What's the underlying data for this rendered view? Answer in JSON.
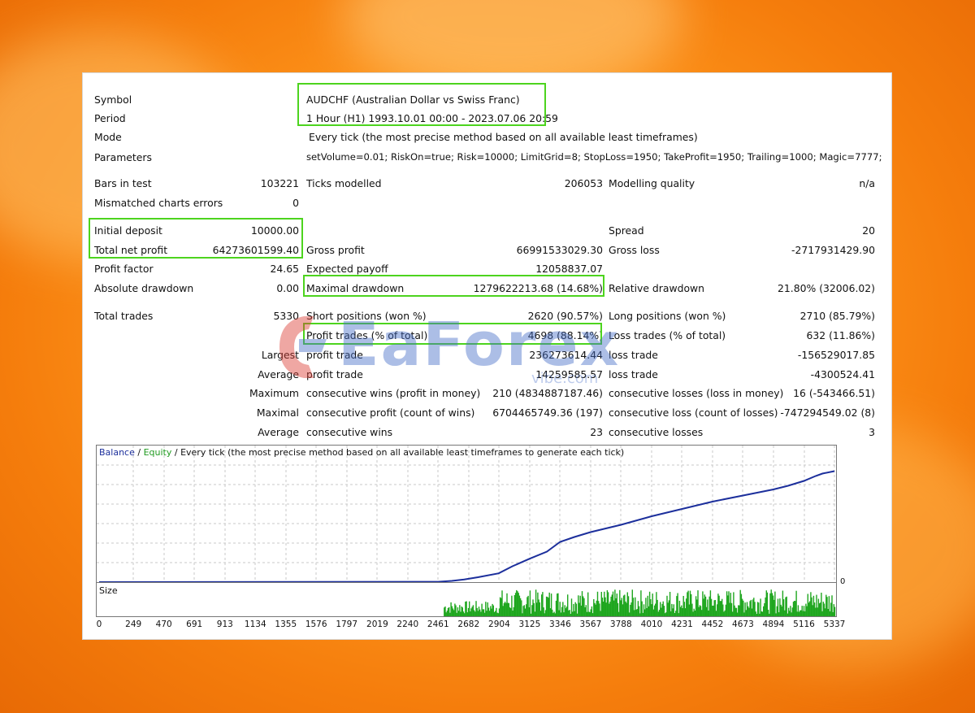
{
  "colors": {
    "balance": "#1c2f9c",
    "equity": "#1f9a1f",
    "volume_bars": "#1fa61f",
    "highlight": "#4dd41e",
    "grid": "#c8c8c8"
  },
  "header": [
    {
      "label": "Symbol",
      "value": "AUDCHF (Australian Dollar vs Swiss Franc)"
    },
    {
      "label": "Period",
      "value": "1 Hour (H1) 1993.10.01 00:00 - 2023.07.06 20:59"
    },
    {
      "label": "Mode",
      "value": "Every tick (the most precise method based on all available least timeframes)"
    },
    {
      "label": "Parameters",
      "value": "setVolume=0.01; RiskOn=true; Risk=10000; LimitGrid=8; StopLoss=1950; TakeProfit=1950; Trailing=1000; Magic=7777;"
    }
  ],
  "bars_in_test": {
    "label": "Bars in test",
    "value": "103221"
  },
  "ticks_modelled": {
    "label": "Ticks modelled",
    "value": "206053"
  },
  "modelling_quality": {
    "label": "Modelling quality",
    "value": "n/a"
  },
  "mismatched": {
    "label": "Mismatched charts errors",
    "value": "0"
  },
  "initial_deposit": {
    "label": "Initial deposit",
    "value": "10000.00"
  },
  "spread": {
    "label": "Spread",
    "value": "20"
  },
  "total_net_profit": {
    "label": "Total net profit",
    "value": "64273601599.40"
  },
  "gross_profit": {
    "label": "Gross profit",
    "value": "66991533029.30"
  },
  "gross_loss": {
    "label": "Gross loss",
    "value": "-2717931429.90"
  },
  "profit_factor": {
    "label": "Profit factor",
    "value": "24.65"
  },
  "expected_payoff": {
    "label": "Expected payoff",
    "value": "12058837.07"
  },
  "absolute_drawdown": {
    "label": "Absolute drawdown",
    "value": "0.00"
  },
  "maximal_drawdown": {
    "label": "Maximal drawdown",
    "value": "1279622213.68 (14.68%)"
  },
  "relative_drawdown": {
    "label": "Relative drawdown",
    "value": "21.80% (32006.02)"
  },
  "total_trades": {
    "label": "Total trades",
    "value": "5330"
  },
  "short_positions": {
    "label": "Short positions (won %)",
    "value": "2620 (90.57%)"
  },
  "long_positions": {
    "label": "Long positions (won %)",
    "value": "2710 (85.79%)"
  },
  "profit_trades": {
    "label": "Profit trades (% of total)",
    "value": "4698 (88.14%)"
  },
  "loss_trades": {
    "label": "Loss trades (% of total)",
    "value": "632 (11.86%)"
  },
  "detail_rows": [
    {
      "prefix": "Largest",
      "l1": "profit trade",
      "v1": "236273614.44",
      "l2": "loss trade",
      "v2": "-156529017.85"
    },
    {
      "prefix": "Average",
      "l1": "profit trade",
      "v1": "14259585.57",
      "l2": "loss trade",
      "v2": "-4300524.41"
    },
    {
      "prefix": "Maximum",
      "l1": "consecutive wins (profit in money)",
      "v1": "210 (4834887187.46)",
      "l2": "consecutive losses (loss in money)",
      "v2": "16 (-543466.51)"
    },
    {
      "prefix": "Maximal",
      "l1": "consecutive profit (count of wins)",
      "v1": "6704465749.36 (197)",
      "l2": "consecutive loss (count of losses)",
      "v2": "-747294549.02 (8)"
    },
    {
      "prefix": "Average",
      "l1": "consecutive wins",
      "v1": "23",
      "l2": "consecutive losses",
      "v2": "3"
    }
  ],
  "watermark": {
    "brand": "EaForex",
    "sub": "vibe.com"
  },
  "graph": {
    "legend_balance": "Balance",
    "legend_sep": " / ",
    "legend_equity": "Equity",
    "legend_rest": " / Every tick (the most precise method based on all available least timeframes to generate each tick)",
    "size_label": "Size",
    "zero_label": "0"
  },
  "chart_data": {
    "type": "line",
    "title": "",
    "xlabel": "",
    "ylabel": "",
    "x_ticks": [
      "0",
      "249",
      "470",
      "691",
      "913",
      "1134",
      "1355",
      "1576",
      "1797",
      "2019",
      "2240",
      "2461",
      "2682",
      "2904",
      "3125",
      "3346",
      "3567",
      "3788",
      "4010",
      "4231",
      "4452",
      "4673",
      "4894",
      "5116",
      "5337"
    ],
    "xlim": [
      0,
      5337
    ],
    "y_scale": "relative (balance, unlabeled)",
    "series": [
      {
        "name": "Balance",
        "x": [
          0,
          2461,
          2560,
          2650,
          2750,
          2900,
          3000,
          3125,
          3250,
          3346,
          3450,
          3567,
          3788,
          4010,
          4231,
          4452,
          4673,
          4894,
          5000,
          5116,
          5200,
          5250,
          5337
        ],
        "values": [
          0,
          0.3,
          1.0,
          2.2,
          4.0,
          7.2,
          13.0,
          19.2,
          25.0,
          33.0,
          37.0,
          41.0,
          47.0,
          54.0,
          60.0,
          66.0,
          71.0,
          76.0,
          79.0,
          83.0,
          87.0,
          89.0,
          91.0
        ]
      }
    ],
    "size_series": {
      "name": "Size",
      "x_start": 2461,
      "x_end": 5337,
      "note": "green trade-size bars"
    },
    "grid": true
  }
}
